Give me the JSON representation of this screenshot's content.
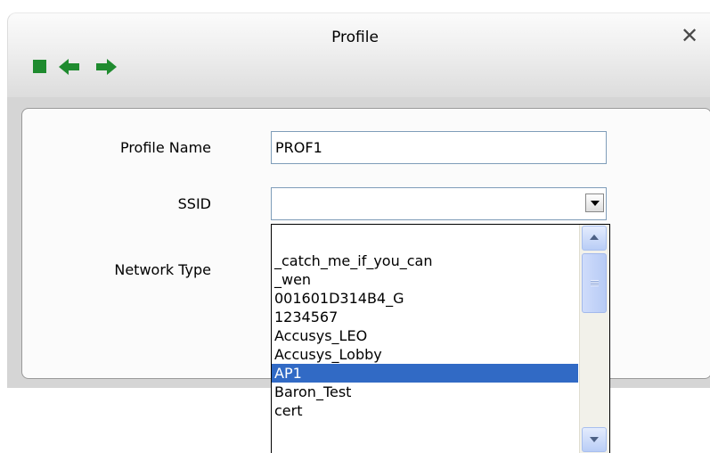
{
  "window": {
    "title": "Profile",
    "close_symbol": "✕"
  },
  "toolbar": {
    "icons": [
      "stop-icon",
      "back-arrow-icon",
      "forward-arrow-icon"
    ]
  },
  "form": {
    "profile_name_label": "Profile Name",
    "profile_name_value": "PROF1",
    "ssid_label": "SSID",
    "ssid_value": "",
    "network_type_label": "Network Type"
  },
  "ssid_dropdown": {
    "items": [
      "_catch_me_if_you_can",
      "_wen",
      "001601D314B4_G",
      "1234567",
      "Accusys_LEO",
      "Accusys_Lobby",
      "AP1",
      "Baron_Test",
      "cert"
    ],
    "selected": "AP1"
  },
  "colors": {
    "selection": "#316ac5",
    "stop_icon": "#1f8b2f",
    "arrow_icon": "#1f8b2f"
  }
}
